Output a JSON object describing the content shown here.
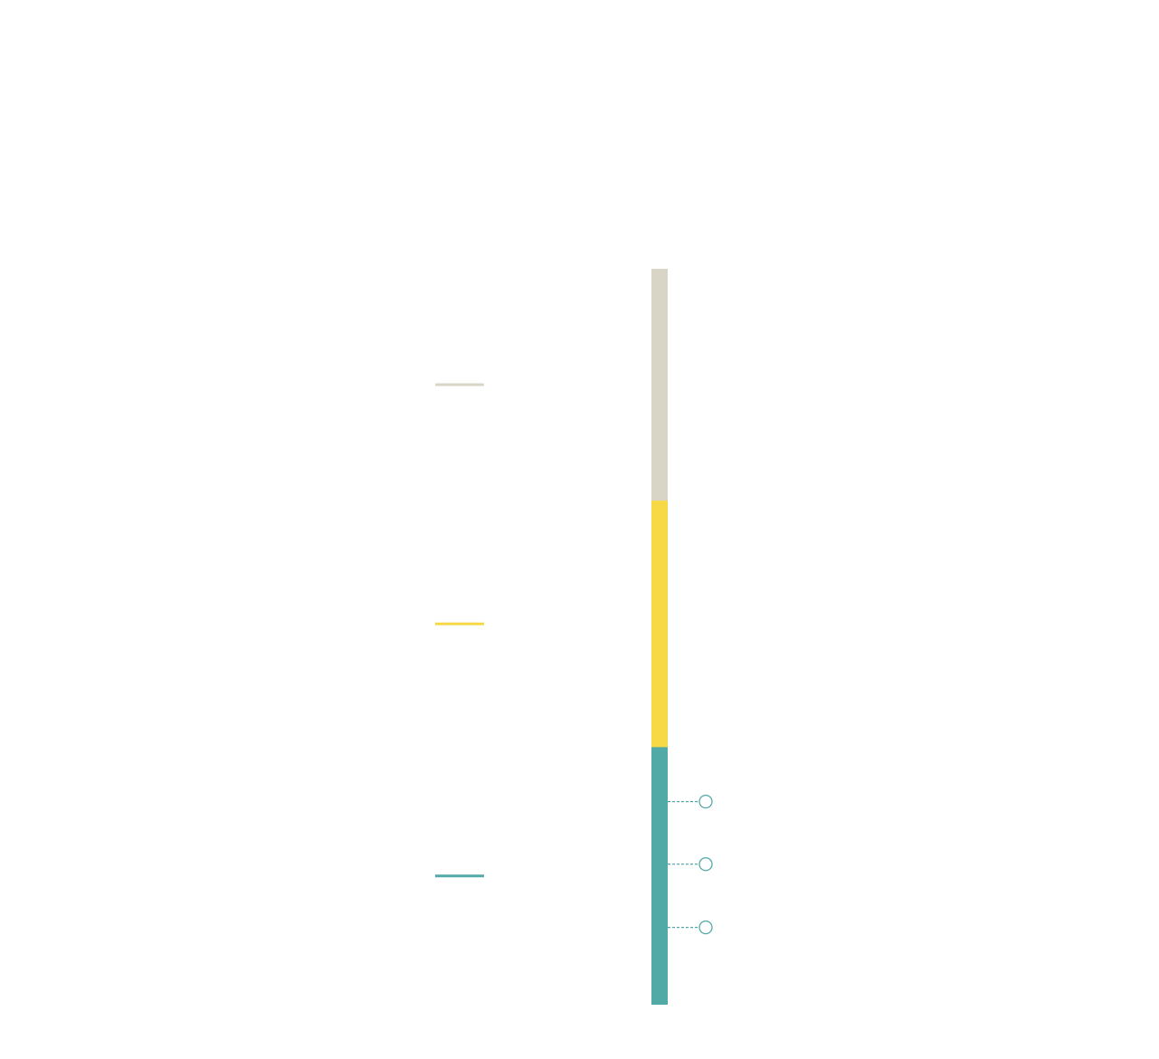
{
  "chart_data": {
    "type": "bar",
    "orientation": "vertical-stacked-single-column",
    "title": "",
    "xlabel": "",
    "ylabel": "",
    "series": [
      {
        "name": "",
        "key": "grey",
        "color": "#d8d5c6",
        "value": 0.315
      },
      {
        "name": "",
        "key": "yellow",
        "color": "#f7d845",
        "value": 0.335
      },
      {
        "name": "",
        "key": "teal",
        "color": "#52aaa7",
        "value": 0.35
      }
    ],
    "legend": {
      "placement": "left",
      "entries": [
        "grey",
        "yellow",
        "teal"
      ]
    },
    "callouts": [
      {
        "series": "teal",
        "position": 0.074
      },
      {
        "series": "teal",
        "position": 0.159
      },
      {
        "series": "teal",
        "position": 0.245
      }
    ],
    "ylim": [
      0,
      1
    ],
    "grid": false
  }
}
